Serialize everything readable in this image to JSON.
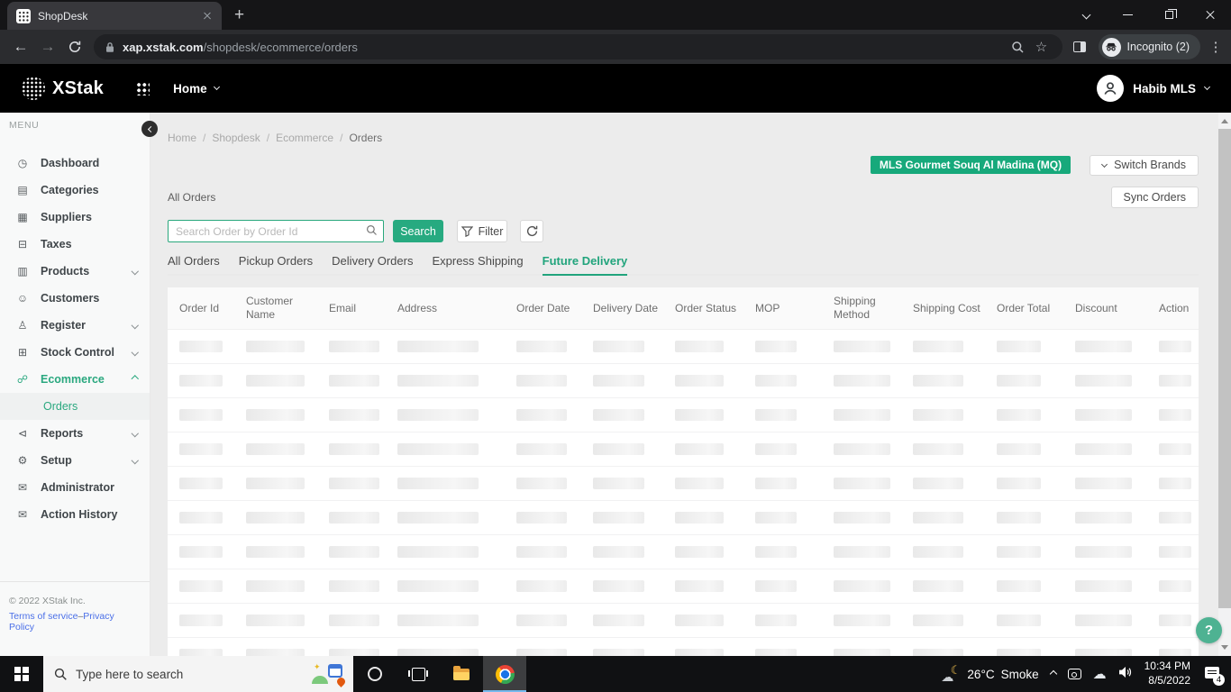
{
  "browser": {
    "tab_title": "ShopDesk",
    "url": {
      "domain": "xap.xstak.com",
      "path": "/shopdesk/ecommerce/orders"
    },
    "incognito_label": "Incognito (2)"
  },
  "app_header": {
    "brand": "XStak",
    "nav_current": "Home",
    "user_name": "Habib MLS"
  },
  "sidebar": {
    "menu_label": "MENU",
    "items": [
      {
        "label": "Dashboard",
        "icon": "dashboard-icon"
      },
      {
        "label": "Categories",
        "icon": "categories-icon"
      },
      {
        "label": "Suppliers",
        "icon": "suppliers-icon"
      },
      {
        "label": "Taxes",
        "icon": "taxes-icon"
      },
      {
        "label": "Products",
        "icon": "products-icon",
        "expandable": true
      },
      {
        "label": "Customers",
        "icon": "customers-icon"
      },
      {
        "label": "Register",
        "icon": "register-icon",
        "expandable": true
      },
      {
        "label": "Stock Control",
        "icon": "stock-control-icon",
        "expandable": true
      },
      {
        "label": "Ecommerce",
        "icon": "ecommerce-icon",
        "expandable": true,
        "expanded": true,
        "active": true
      },
      {
        "label": "Orders",
        "type": "sub",
        "active": true
      },
      {
        "label": "Reports",
        "icon": "reports-icon",
        "expandable": true
      },
      {
        "label": "Setup",
        "icon": "setup-icon",
        "expandable": true
      },
      {
        "label": "Administrator",
        "icon": "administrator-icon"
      },
      {
        "label": "Action History",
        "icon": "action-history-icon"
      }
    ],
    "footer": {
      "copyright": "© 2022 XStak Inc.",
      "terms_link": "Terms of service",
      "separator": "–",
      "privacy_link": "Privacy Policy"
    }
  },
  "main": {
    "breadcrumb": [
      "Home",
      "Shopdesk",
      "Ecommerce",
      "Orders"
    ],
    "brand_badge": "MLS Gourmet Souq Al Madina (MQ)",
    "switch_brands_button": "Switch Brands",
    "sync_orders_button": "Sync Orders",
    "section_title": "All Orders",
    "search": {
      "placeholder": "Search Order by Order Id",
      "search_button": "Search",
      "filter_button": "Filter"
    },
    "tabs": [
      {
        "label": "All Orders",
        "active": false
      },
      {
        "label": "Pickup Orders",
        "active": false
      },
      {
        "label": "Delivery Orders",
        "active": false
      },
      {
        "label": "Express Shipping",
        "active": false
      },
      {
        "label": "Future Delivery",
        "active": true
      }
    ],
    "table": {
      "columns": [
        "Order Id",
        "Customer Name",
        "Email",
        "Address",
        "Order Date",
        "Delivery Date",
        "Order Status",
        "MOP",
        "Shipping Method",
        "Shipping Cost",
        "Order Total",
        "Discount",
        "Action"
      ],
      "skeleton_row_count": 10,
      "loading": true
    },
    "help_button": "?"
  },
  "taskbar": {
    "search_placeholder": "Type here to search",
    "weather": {
      "temp": "26°C",
      "condition": "Smoke"
    },
    "clock": {
      "time": "10:34 PM",
      "date": "8/5/2022"
    },
    "notification_count": "4"
  },
  "icons": {
    "new_tab": "+",
    "back_arrow": "←",
    "forward_arrow": "→",
    "star": "☆",
    "overflow_menu": "⋮",
    "sparkle": "✦",
    "moon": "☾",
    "cloud": "☁",
    "sidebar_glyphs": {
      "dashboard-icon": "◷",
      "categories-icon": "▤",
      "suppliers-icon": "▦",
      "taxes-icon": "⊟",
      "products-icon": "▥",
      "customers-icon": "☺",
      "register-icon": "♙",
      "stock-control-icon": "⊞",
      "ecommerce-icon": "☍",
      "reports-icon": "⊲",
      "setup-icon": "⚙",
      "administrator-icon": "✉",
      "action-history-icon": "✉"
    }
  },
  "colors": {
    "accent_green": "#21a47c",
    "badge_green": "#17a97b",
    "link_blue": "#4a6fe8",
    "taskbar_active_underline": "#76b9ed"
  }
}
